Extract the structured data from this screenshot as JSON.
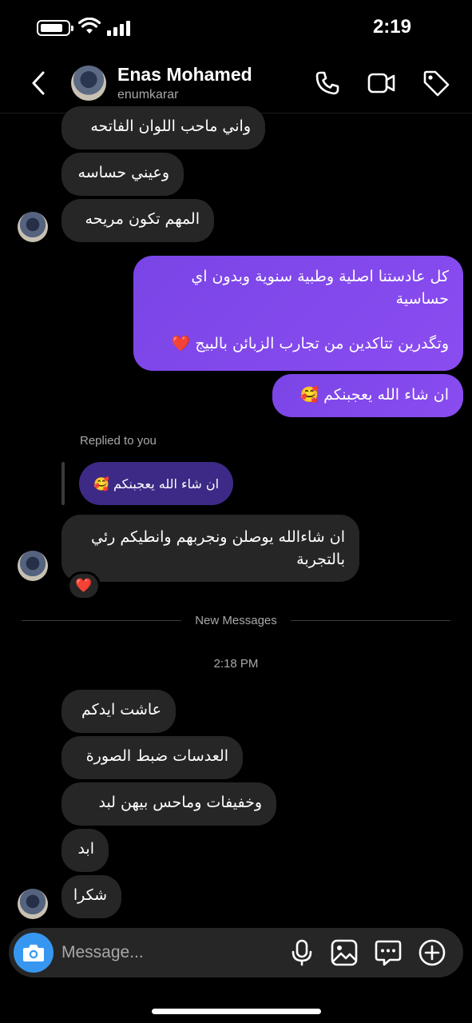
{
  "status_bar": {
    "time": "2:19",
    "battery_level": 0.85
  },
  "header": {
    "name": "Enas Mohamed",
    "username": "enumkarar",
    "icons": [
      "chevron-left-icon",
      "phone-icon",
      "video-camera-icon",
      "tag-icon"
    ]
  },
  "messages": {
    "m1": "واني ماحب اللوان الفاتحه",
    "m2": "وعيني حساسه",
    "m3": "المهم تكون مريحه",
    "m4": "كل عادستنا اصلية وطبية سنوية وبدون اي حساسية\n\nوتگدرين تتاكدين من تجارب الزبائن بالبيج ❤️",
    "m5": "ان شاء الله يعجبنكم 🥰",
    "replied_label": "Replied to you",
    "reply_quote": "ان شاء الله يعجبنكم 🥰",
    "m6": "ان شاءالله يوصلن ونجربهم وانطيكم رئي بالتجربة",
    "m6_reaction": "❤️",
    "divider": "New Messages",
    "timestamp": "2:18 PM",
    "m7": "عاشت ايدكم",
    "m8": "العدسات ضبط الصورة",
    "m9": "وخفيفات وماحس بيهن لبد",
    "m10": "ابد",
    "m11": "شكرا"
  },
  "composer": {
    "placeholder": "Message...",
    "icons": [
      "camera-icon",
      "microphone-icon",
      "gallery-icon",
      "sticker-icon",
      "add-icon"
    ]
  },
  "colors": {
    "outgoing_bubble": "#8a4cf0",
    "incoming_bubble": "#262626",
    "camera_button": "#3797f0",
    "reply_quote": "#3d2a86"
  }
}
